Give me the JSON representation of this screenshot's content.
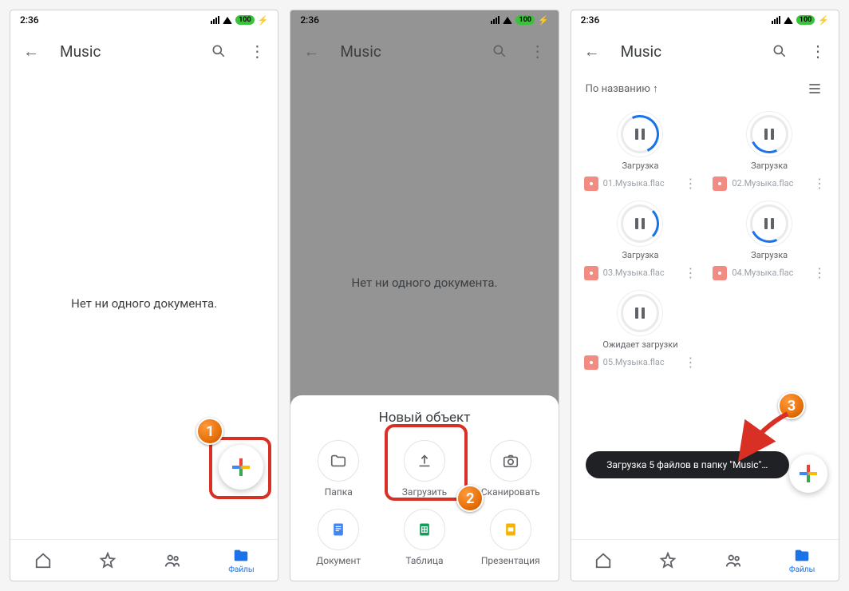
{
  "status": {
    "time": "2:36",
    "battery": "100"
  },
  "appbar": {
    "title": "Music"
  },
  "empty_message": "Нет ни одного документа.",
  "bottomnav": {
    "home": "",
    "starred": "",
    "shared": "",
    "files": "Файлы"
  },
  "sheet": {
    "title": "Новый объект",
    "items": {
      "folder": "Папка",
      "upload": "Загрузить",
      "scan": "Сканировать",
      "doc": "Документ",
      "sheet": "Таблица",
      "slides": "Презентация"
    }
  },
  "sort": {
    "label": "По названию",
    "arrow": "↑"
  },
  "loading_label": "Загрузка",
  "waiting_label": "Ожидает загрузки",
  "files": [
    {
      "name": "01.Музыка.flac"
    },
    {
      "name": "02.Музыка.flac"
    },
    {
      "name": "03.Музыка.flac"
    },
    {
      "name": "04.Музыка.flac"
    },
    {
      "name": "05.Музыка.flac"
    }
  ],
  "toast": "Загрузка 5 файлов в папку \"Music\"…",
  "callouts": {
    "b1": "1",
    "b2": "2",
    "b3": "3"
  }
}
